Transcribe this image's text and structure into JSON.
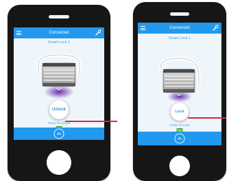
{
  "colors": {
    "accent": "#2299ee",
    "phone_body": "#161616",
    "screen_bg": "#eef5fb",
    "pointer": "#d6263e",
    "battery": "#7fd04d"
  },
  "icons": {
    "menu": "hamburger-menu-icon",
    "settings": "wrench-settings-icon",
    "lock_device": "padlock-illustration",
    "expand": "chevron-up-icon"
  },
  "screens": [
    {
      "header_title": "Connected",
      "lock_name": "Smart Lock 1",
      "shackle_state": "locked",
      "action_label": "Unlock",
      "hint_text": "Press To Unlock"
    },
    {
      "header_title": "Connected",
      "lock_name": "Smart Lock 1",
      "shackle_state": "open",
      "action_label": "Lock",
      "hint_text": "Press To Lock"
    }
  ]
}
